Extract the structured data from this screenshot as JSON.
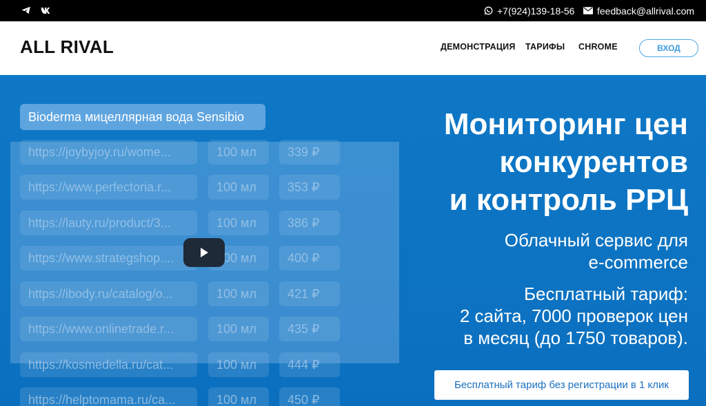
{
  "topbar": {
    "phone": "+7(924)139-18-56",
    "email": "feedback@allrival.com",
    "social_icons": [
      "telegram-icon",
      "vk-icon"
    ]
  },
  "header": {
    "logo": "ALL RIVAL",
    "nav": [
      "ДЕМОНСТРАЦИЯ",
      "ТАРИФЫ",
      "CHROME"
    ],
    "login_label": "ВХОД"
  },
  "demo": {
    "query": "Bioderma мицеллярная вода Sensibio",
    "rows": [
      {
        "url": "https://joybyjoy.ru/wome...",
        "volume": "100 мл",
        "price": "339 ₽"
      },
      {
        "url": "https://www.perfectoria.r...",
        "volume": "100 мл",
        "price": "353 ₽"
      },
      {
        "url": "https://lauty.ru/product/3...",
        "volume": "100 мл",
        "price": "386 ₽"
      },
      {
        "url": "https://www.strategshop....",
        "volume": "100 мл",
        "price": "400 ₽"
      },
      {
        "url": "https://ibody.ru/catalog/o...",
        "volume": "100 мл",
        "price": "421 ₽"
      },
      {
        "url": "https://www.onlinetrade.r...",
        "volume": "100 мл",
        "price": "435 ₽"
      },
      {
        "url": "https://kosmedella.ru/cat...",
        "volume": "100 мл",
        "price": "444 ₽"
      },
      {
        "url": "https://helptomama.ru/ca...",
        "volume": "100 мл",
        "price": "450 ₽"
      }
    ]
  },
  "hero": {
    "headline_1": "Мониторинг цен",
    "headline_2": "конкурентов",
    "headline_3": "и контроль РРЦ",
    "sub1_line1": "Облачный сервис для",
    "sub1_line2": "e-commerce",
    "sub2_line1": "Бесплатный тариф:",
    "sub2_line2": "2 сайта, 7000 проверок цен",
    "sub2_line3": "в месяц (до 1750 товаров).",
    "cta_label": "Бесплатный тариф без регистрации в 1 клик"
  },
  "colors": {
    "hero_bg": "#0d74c4",
    "accent": "#3b9be0"
  }
}
